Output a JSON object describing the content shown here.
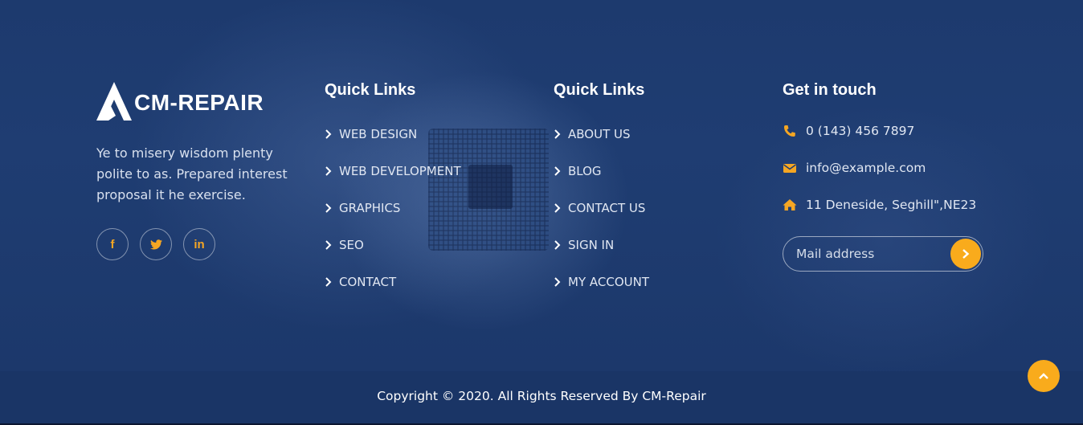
{
  "brand": {
    "name": "CM-REPAIR",
    "about": "Ye to misery wisdom plenty polite to as. Prepared interest proposal it he exercise.",
    "logo_icon": "triangle-logo-icon"
  },
  "socials": [
    {
      "name": "facebook",
      "icon": "facebook-icon",
      "glyph": "f"
    },
    {
      "name": "twitter",
      "icon": "twitter-icon"
    },
    {
      "name": "linkedin",
      "icon": "linkedin-icon",
      "glyph": "in"
    }
  ],
  "quick_links_1": {
    "title": "Quick Links",
    "items": [
      "WEB DESIGN",
      "WEB DEVELOPMENT",
      "GRAPHICS",
      "SEO",
      "CONTACT"
    ]
  },
  "quick_links_2": {
    "title": "Quick Links",
    "items": [
      "ABOUT US",
      "BLOG",
      "CONTACT US",
      "SIGN IN",
      "MY ACCOUNT"
    ]
  },
  "contact": {
    "title": "Get in touch",
    "phone": "0 (143) 456 7897",
    "email": "info@example.com",
    "address": "11 Deneside, Seghill\",NE23",
    "newsletter_placeholder": "Mail address"
  },
  "footer": {
    "copyright": "Copyright © 2020. All Rights Reserved By CM-Repair"
  },
  "colors": {
    "accent": "#f9ab1c",
    "background": "#1a3566",
    "text": "#e1e7f2"
  }
}
